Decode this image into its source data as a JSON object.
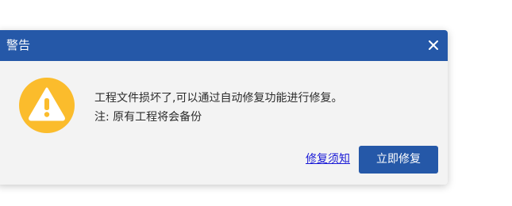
{
  "dialog": {
    "title": "警告",
    "close_icon": "close-icon",
    "warning_icon": "warning-icon",
    "message": "工程文件损坏了,可以通过自动修复功能进行修复。",
    "note": "注: 原有工程将会备份",
    "link_label": "修复须知",
    "primary_button_label": "立即修复"
  },
  "colors": {
    "titlebar": "#2558a8",
    "dialog_background": "#f3f3f3",
    "warning_icon": "#fbbc2c",
    "link": "#1a1ad6",
    "primary_button": "#2558a8"
  }
}
